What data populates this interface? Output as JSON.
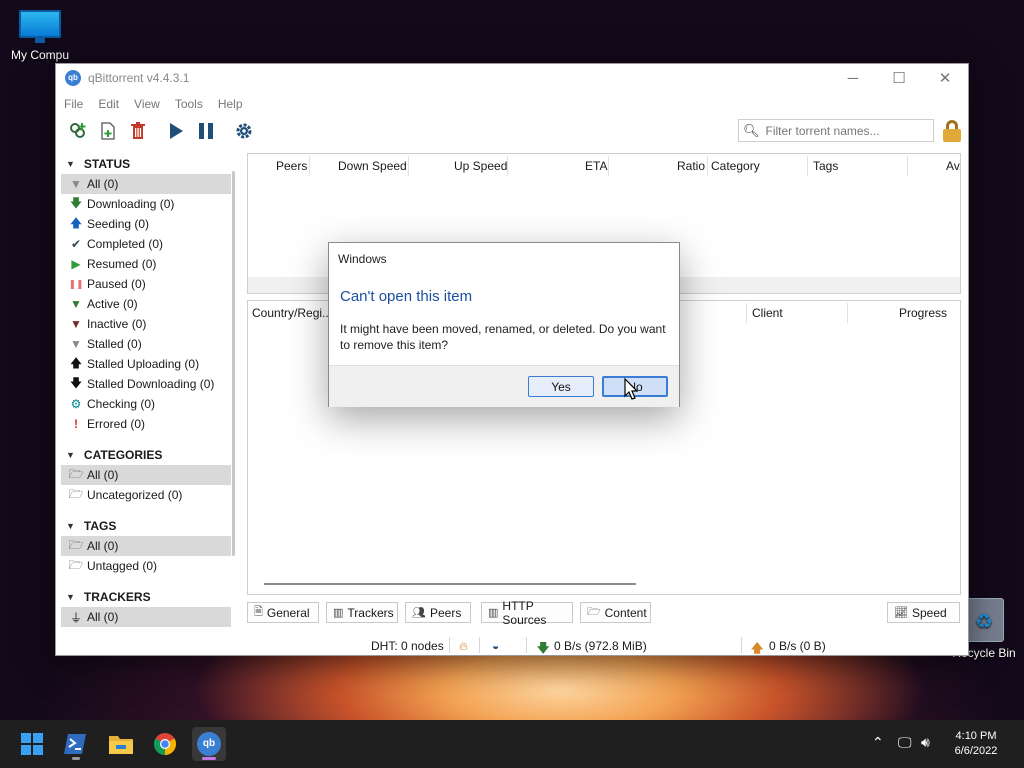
{
  "desktop": {
    "icons": [
      {
        "label": "My Compu",
        "icon": "monitor-icon"
      },
      {
        "label": "Recycle Bin",
        "icon": "recycle-bin-icon"
      }
    ]
  },
  "window": {
    "title": "qBittorrent v4.4.3.1",
    "app_icon_text": "qb",
    "controls": {
      "minimize": "─",
      "maximize": "☐",
      "close": "✕"
    }
  },
  "menu": [
    "File",
    "Edit",
    "View",
    "Tools",
    "Help"
  ],
  "toolbar": {
    "search_placeholder": "Filter torrent names...",
    "buttons": [
      "add-torrent-link",
      "add-torrent-file",
      "delete",
      "resume",
      "pause",
      "options"
    ]
  },
  "sidebar": {
    "status": {
      "header": "STATUS",
      "items": [
        {
          "label": "All (0)",
          "icon": "filter-icon",
          "color": "#888888"
        },
        {
          "label": "Downloading (0)",
          "icon": "arrow-down-icon",
          "color": "#2e7d32"
        },
        {
          "label": "Seeding (0)",
          "icon": "arrow-up-icon",
          "color": "#1565c0"
        },
        {
          "label": "Completed (0)",
          "icon": "checkmark-icon",
          "color": "#37474f"
        },
        {
          "label": "Resumed (0)",
          "icon": "play-icon",
          "color": "#2e9d3a"
        },
        {
          "label": "Paused (0)",
          "icon": "pause-icon",
          "color": "#e57373"
        },
        {
          "label": "Active (0)",
          "icon": "filter-icon",
          "color": "#2e7d32"
        },
        {
          "label": "Inactive (0)",
          "icon": "filter-icon",
          "color": "#7b2a2a"
        },
        {
          "label": "Stalled (0)",
          "icon": "filter-icon",
          "color": "#888888"
        },
        {
          "label": "Stalled Uploading (0)",
          "icon": "arrow-up-icon",
          "color": "#111111"
        },
        {
          "label": "Stalled Downloading (0)",
          "icon": "arrow-down-icon",
          "color": "#111111"
        },
        {
          "label": "Checking (0)",
          "icon": "gear-icon",
          "color": "#00838f"
        },
        {
          "label": "Errored (0)",
          "icon": "exclamation-icon",
          "color": "#d32f2f"
        }
      ]
    },
    "categories": {
      "header": "CATEGORIES",
      "items": [
        "All (0)",
        "Uncategorized (0)"
      ]
    },
    "tags": {
      "header": "TAGS",
      "items": [
        "All (0)",
        "Untagged (0)"
      ]
    },
    "trackers": {
      "header": "TRACKERS",
      "items": [
        "All (0)"
      ]
    }
  },
  "torrent_list": {
    "columns": [
      "Peers",
      "Down Speed",
      "Up Speed",
      "ETA",
      "Ratio",
      "Category",
      "Tags",
      "Av"
    ]
  },
  "peer_list": {
    "columns": [
      "Country/Regi...",
      "Client",
      "Progress"
    ]
  },
  "tabs": [
    "General",
    "Trackers",
    "Peers",
    "HTTP Sources",
    "Content"
  ],
  "speed_button": "Speed",
  "statusbar": {
    "dht": "DHT: 0 nodes",
    "download": "0 B/s (972.8 MiB)",
    "upload": "0 B/s (0 B)"
  },
  "dialog": {
    "title": "Windows",
    "heading": "Can't open this item",
    "message": "It might have been moved, renamed, or deleted. Do you want to remove this item?",
    "yes": "Yes",
    "no": "No"
  },
  "taskbar": {
    "time": "4:10 PM",
    "date": "6/6/2022",
    "apps": [
      "start",
      "terminal",
      "file-explorer",
      "chrome",
      "qbittorrent"
    ]
  },
  "colors": {
    "accent": "#1c4fa0",
    "button_border": "#3a7bd5",
    "selection": "#d9d9d9",
    "taskbar": "#1f1f1f"
  }
}
